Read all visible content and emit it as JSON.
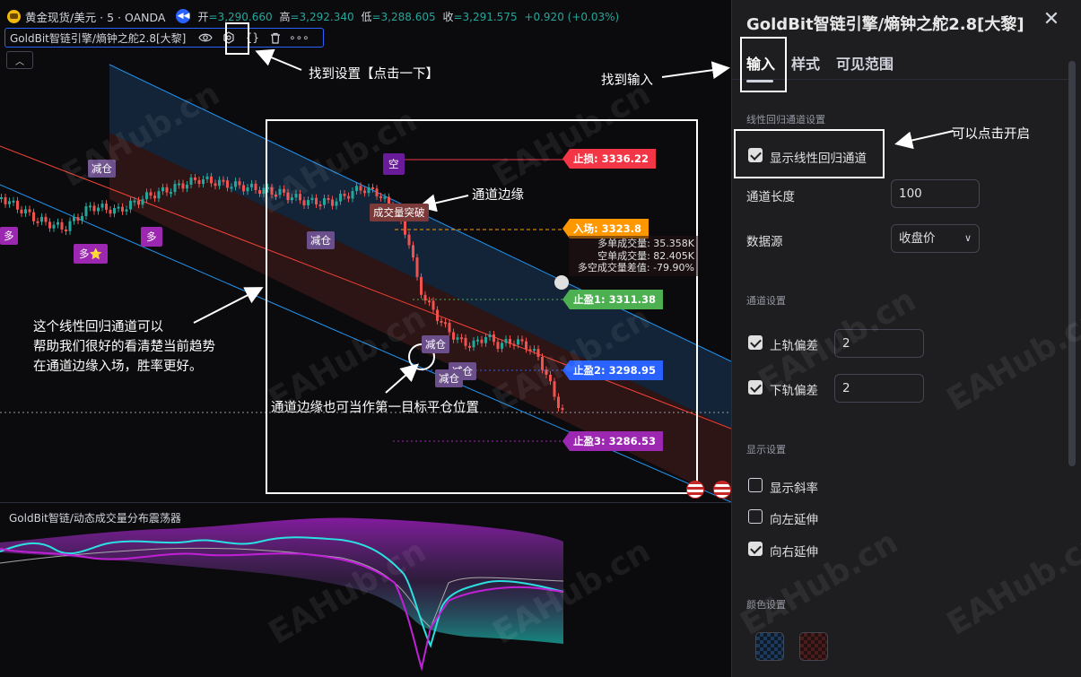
{
  "header": {
    "symbol": "黄金现货/美元 · 5 · OANDA",
    "open_label": "开",
    "open": "=3,290.660",
    "high_label": "高",
    "high": "=3,292.340",
    "low_label": "低",
    "low": "=3,288.605",
    "close_label": "收",
    "close": "=3,291.575",
    "change": "+0.920 (+0.03%)"
  },
  "indicator_bar": {
    "name": "GoldBit智链引擎/熵钟之舵2.8[大黎]",
    "icons": [
      "eye-icon",
      "settings-icon",
      "code-icon",
      "trash-icon",
      "more-icon"
    ],
    "code_glyph": "{}",
    "more_glyph": "∘∘∘"
  },
  "annotations": {
    "find_settings": "找到设置【点击一下】",
    "find_input": "找到输入",
    "channel_edge": "通道边缘",
    "can_enable": "可以点击开启",
    "explain_1": "这个线性回归通道可以",
    "explain_2": "帮助我们很好的看清楚当前趋势",
    "explain_3": "在通道边缘入场，胜率更好。",
    "first_target": "通道边缘也可当作第一目标平仓位置"
  },
  "price_tags": {
    "stop_loss": "止损: 3336.22",
    "entry": "入场: 3323.8",
    "tp1": "止盈1: 3311.38",
    "tp2": "止盈2: 3298.95",
    "tp3": "止盈3: 3286.53"
  },
  "volume_info": {
    "long_vol": "多单成交量: 35.358K",
    "short_vol": "空单成交量: 82.405K",
    "diff": "多空成交量差值: -79.90%"
  },
  "signals": {
    "reduce": "减仓",
    "long": "多",
    "long_star": "多⭐",
    "short": "空",
    "volume_break": "成交量突破"
  },
  "sub_pane": {
    "title": "GoldBit智链/动态成交量分布震荡器"
  },
  "watermark": "EAHub.cn",
  "dialog": {
    "title": "GoldBit智链引擎/熵钟之舵2.8[大黎]",
    "tabs": [
      "输入",
      "样式",
      "可见范围"
    ],
    "sections": {
      "linreg": "线性回归通道设置",
      "channel": "通道设置",
      "display": "显示设置",
      "color": "颜色设置"
    },
    "show_channel_label": "显示线性回归通道",
    "show_channel_checked": true,
    "length_label": "通道长度",
    "length_value": "100",
    "source_label": "数据源",
    "source_value": "收盘价",
    "upper_dev_label": "上轨偏差",
    "upper_dev_checked": true,
    "upper_dev_value": "2",
    "lower_dev_label": "下轨偏差",
    "lower_dev_checked": true,
    "lower_dev_value": "2",
    "show_slope_label": "显示斜率",
    "show_slope_checked": false,
    "extend_left_label": "向左延伸",
    "extend_left_checked": false,
    "extend_right_label": "向右延伸",
    "extend_right_checked": true
  },
  "colors": {
    "up": "#26a69a",
    "down": "#ef5350",
    "stop_loss": "#f23645",
    "entry": "#ff9800",
    "tp1": "#4caf50",
    "tp2": "#2962ff",
    "tp3": "#9c27b0",
    "channel_upper": "#2196f3",
    "channel_mid": "#f44336"
  }
}
